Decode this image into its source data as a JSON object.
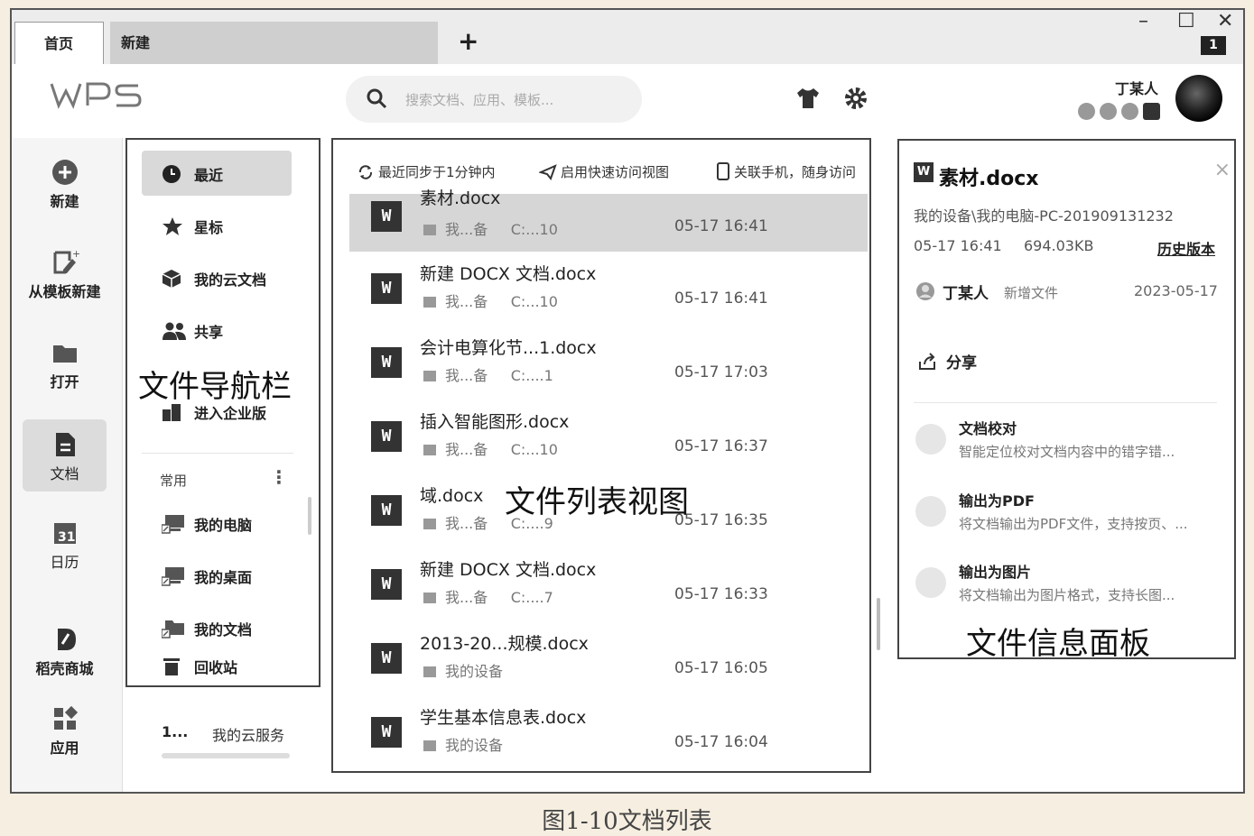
{
  "tabs": [
    {
      "label": "首页"
    },
    {
      "label": "新建"
    }
  ],
  "tab_add": "+",
  "window": {
    "badge": "1",
    "minimize": "–",
    "maximize": "☐",
    "close": "✕"
  },
  "header": {
    "logo": "WPS",
    "search_placeholder": "搜索文档、应用、模板...",
    "user_name": "丁某人",
    "icons": [
      "headset-icon",
      "skin-icon",
      "settings-icon"
    ]
  },
  "leftbar": [
    {
      "label": "新建",
      "icon": "plus-circle-icon"
    },
    {
      "label": "从模板新建",
      "icon": "template-icon"
    },
    {
      "label": "打开",
      "icon": "folder-icon"
    },
    {
      "label": "文档",
      "icon": "document-icon",
      "active": true
    },
    {
      "label": "日历",
      "icon": "calendar-icon"
    },
    {
      "label": "稻壳商城",
      "icon": "store-icon"
    },
    {
      "label": "应用",
      "icon": "apps-icon"
    }
  ],
  "nav": {
    "items": [
      {
        "label": "最近",
        "icon": "clock-icon",
        "active": true
      },
      {
        "label": "星标",
        "icon": "star-icon"
      },
      {
        "label": "我的云文档",
        "icon": "cloud-cube-icon"
      },
      {
        "label": "共享",
        "icon": "users-icon"
      },
      {
        "label": "进入企业版",
        "icon": "enterprise-icon"
      }
    ],
    "section_label": "常用",
    "section_more": "⋮",
    "common": [
      {
        "label": "我的电脑",
        "icon": "computer-icon"
      },
      {
        "label": "我的桌面",
        "icon": "desktop-icon"
      },
      {
        "label": "我的文档",
        "icon": "folder-docs-icon"
      },
      {
        "label": "回收站",
        "icon": "trash-icon"
      }
    ],
    "caption": "文件导航栏"
  },
  "cloud_service": {
    "num": "1...",
    "label": "我的云服务"
  },
  "file_list": {
    "actions": [
      {
        "label": "最近同步于1分钟内",
        "icon": "sync-icon"
      },
      {
        "label": "启用快速访问视图",
        "icon": "send-icon"
      },
      {
        "label": "关联手机，随身访问",
        "icon": "phone-icon"
      }
    ],
    "files": [
      {
        "name": "素材.docx",
        "location": "我...备",
        "path": "C:...10",
        "date": "05-17 16:41",
        "selected": true
      },
      {
        "name": "新建 DOCX 文档.docx",
        "location": "我...备",
        "path": "C:...10",
        "date": "05-17 16:41"
      },
      {
        "name": "会计电算化节...1.docx",
        "location": "我...备",
        "path": "C:....1",
        "date": "05-17 17:03"
      },
      {
        "name": "插入智能图形.docx",
        "location": "我...备",
        "path": "C:...10",
        "date": "05-17 16:37"
      },
      {
        "name": "域.docx",
        "location": "我...备",
        "path": "C:....9",
        "date": "05-17 16:35"
      },
      {
        "name": "新建 DOCX 文档.docx",
        "location": "我...备",
        "path": "C:....7",
        "date": "05-17 16:33"
      },
      {
        "name": "2013-20...规模.docx",
        "location": "我的设备",
        "path": "",
        "date": "05-17 16:05"
      },
      {
        "name": "学生基本信息表.docx",
        "location": "我的设备",
        "path": "",
        "date": "05-17 16:04"
      }
    ],
    "file_icon": "W",
    "caption": "文件列表视图"
  },
  "info": {
    "title": "素材.docx",
    "title_icon": "W",
    "path": "我的设备\\我的电脑-PC-201909131232",
    "time": "05-17 16:41",
    "size": "694.03KB",
    "history": "历史版本",
    "user": "丁某人",
    "user_action": "新增文件",
    "user_date": "2023-05-17",
    "share": "分享",
    "close": "×",
    "tools": [
      {
        "title": "文档校对",
        "desc": "智能定位校对文档内容中的错字错...",
        "icon": "proofread-icon"
      },
      {
        "title": "输出为PDF",
        "desc": "将文档输出为PDF文件，支持按页、...",
        "icon": "pdf-export-icon"
      },
      {
        "title": "输出为图片",
        "desc": "将文档输出为图片格式，支持长图...",
        "icon": "image-export-icon"
      }
    ],
    "caption": "文件信息面板"
  },
  "figure_caption": "图1-10文档列表"
}
